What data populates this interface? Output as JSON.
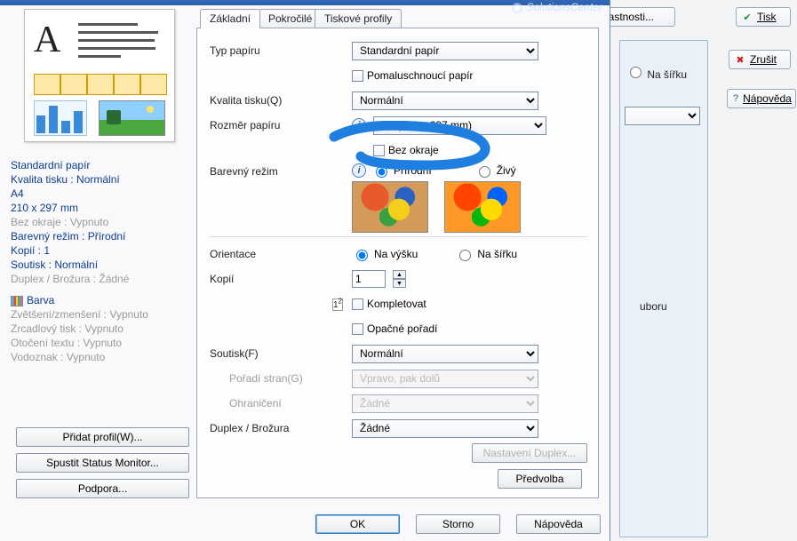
{
  "titlebar": {
    "solutions": "SolutionsCenter"
  },
  "bg": {
    "properties": "Vlastnosti...",
    "print": "Tisk",
    "cancel": "Zrušit",
    "help": "Nápověda",
    "width_radio": "Na šířku",
    "uboru": "uboru"
  },
  "tabs": {
    "basic": "Základní",
    "advanced": "Pokročilé",
    "profiles": "Tiskové profily"
  },
  "labels": {
    "paper_type": "Typ papíru",
    "quality": "Kvalita tisku(Q)",
    "paper_size": "Rozměr papíru",
    "color_mode": "Barevný režim",
    "orientation": "Orientace",
    "copies": "Kopií",
    "soutisk": "Soutisk(F)",
    "page_order": "Pořadí stran(G)",
    "border": "Ohraničení",
    "duplex": "Duplex / Brožura"
  },
  "values": {
    "paper_type": "Standardní papír",
    "quality": "Normální",
    "paper_size": "A4 (210 x 297 mm)",
    "slow_dry": "Pomaluschnoucí papír",
    "borderless": "Bez okraje",
    "natural": "Přírodní",
    "vivid": "Živý",
    "portrait": "Na výšku",
    "landscape": "Na šířku",
    "copies_n": "1",
    "collate": "Kompletovat",
    "reverse": "Opačné pořadí",
    "soutisk": "Normální",
    "page_order": "Vpravo, pak dolů",
    "border": "Žádné",
    "duplex": "Žádné",
    "duplex_settings": "Nastavení Duplex...",
    "preset": "Předvolba",
    "ok": "OK",
    "storno": "Storno",
    "help": "Nápověda"
  },
  "summary": {
    "l1": "Standardní papír",
    "l2": "Kvalita tisku : Normální",
    "l3": "A4",
    "l4": "210 x 297 mm",
    "l5": "Bez okraje : Vypnuto",
    "l6": "Barevný režim : Přírodní",
    "l7": "Kopií : 1",
    "l8": "Soutisk : Normální",
    "l9": "Duplex / Brožura : Žádné",
    "c1": "Barva",
    "g1": "Zvětšení/zmenšení : Vypnuto",
    "g2": "Zrcadlový tisk : Vypnuto",
    "g3": "Otočení textu : Vypnuto",
    "g4": "Vodoznak : Vypnuto"
  },
  "sidebuttons": {
    "add_profile": "Přidat profil(W)...",
    "status_monitor": "Spustit Status Monitor...",
    "support": "Podpora..."
  }
}
